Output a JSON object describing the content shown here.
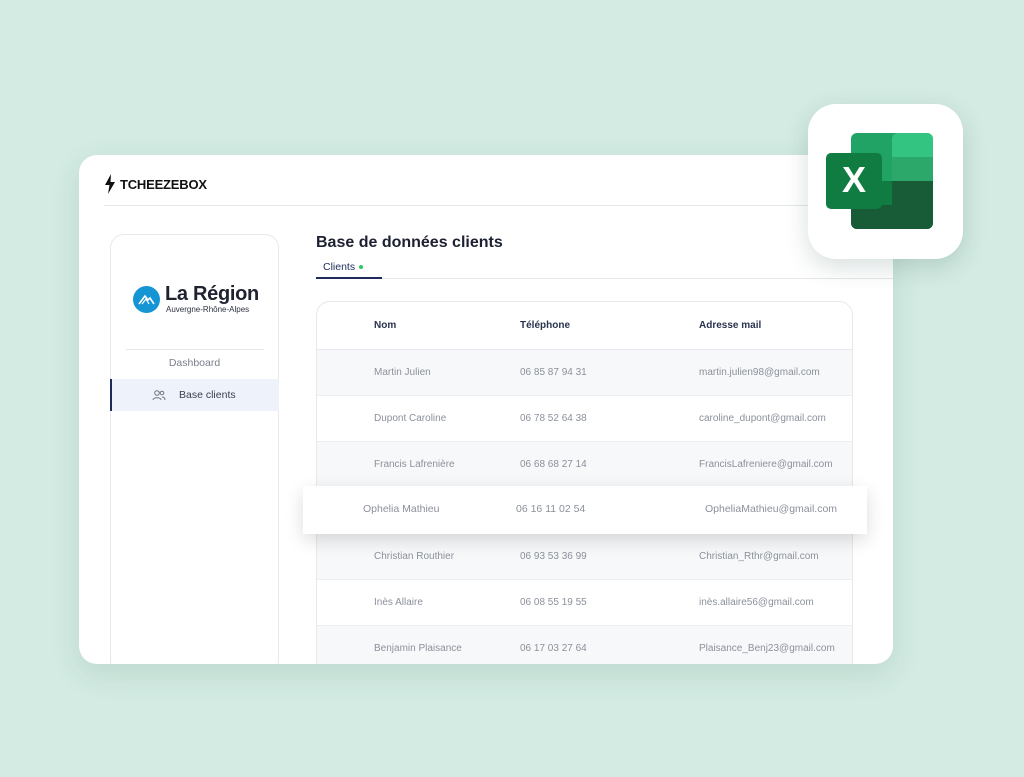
{
  "brand": {
    "name": "TCHEEZEBOX"
  },
  "sidebar": {
    "logo_title": "La Région",
    "logo_subtitle": "Auvergne-Rhône-Alpes",
    "items": [
      {
        "label": "Dashboard",
        "active": false
      },
      {
        "label": "Base clients",
        "active": true,
        "icon": "users-icon"
      }
    ]
  },
  "main": {
    "title": "Base de données clients",
    "tabs": [
      {
        "label": "Clients",
        "status": "green-dot"
      }
    ]
  },
  "table": {
    "columns": [
      "Nom",
      "Téléphone",
      "Adresse mail"
    ],
    "rows": [
      {
        "name": "Martin Julien",
        "phone": "06 85 87 94 31",
        "email": "martin.julien98@gmail.com"
      },
      {
        "name": "Dupont Caroline",
        "phone": "06 78 52 64 38",
        "email": "caroline_dupont@gmail.com"
      },
      {
        "name": "Francis Lafrenière",
        "phone": "06 68 68 27 14",
        "email": "FrancisLafreniere@gmail.com"
      },
      {
        "name": "Ophelia Mathieu",
        "phone": "06 16 11 02 54",
        "email": "OpheliaMathieu@gmail.com"
      },
      {
        "name": "Christian Routhier",
        "phone": "06 93 53 36 99",
        "email": "Christian_Rthr@gmail.com"
      },
      {
        "name": "Inès Allaire",
        "phone": "06 08 55 19 55",
        "email": "inès.allaire56@gmail.com"
      },
      {
        "name": "Benjamin Plaisance",
        "phone": "06 17 03 27 64",
        "email": "Plaisance_Benj23@gmail.com"
      }
    ]
  },
  "excel_icon": {
    "icon": "excel-icon",
    "letter": "X"
  },
  "colors": {
    "background": "#d3ebe2",
    "accent": "#1f2b5a",
    "logo_blue": "#1695d4",
    "status_green": "#2fc766",
    "excel_green": "#1d6f42"
  }
}
